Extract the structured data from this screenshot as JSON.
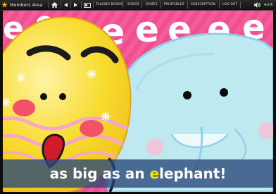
{
  "app": {
    "title": "Members Area"
  },
  "toolbar": {
    "nav": [
      "TALKING BOOKS",
      "SONGS",
      "GAMES",
      "PRINTABLES",
      "SUBSCRIPTION",
      "LOG OUT"
    ],
    "exit_label": "exit",
    "icons": [
      "home-icon",
      "previous-icon",
      "next-icon",
      "fullscreen-icon",
      "sound-icon"
    ]
  },
  "caption": {
    "before": "as big as an ",
    "highlight": "e",
    "after": "lephant!"
  },
  "colors": {
    "background": "#f35d99",
    "egg": "#f7dc2d",
    "elephant": "#bfe9f1",
    "caption_bg": "#284878",
    "caption_highlight": "#f5e00a"
  }
}
